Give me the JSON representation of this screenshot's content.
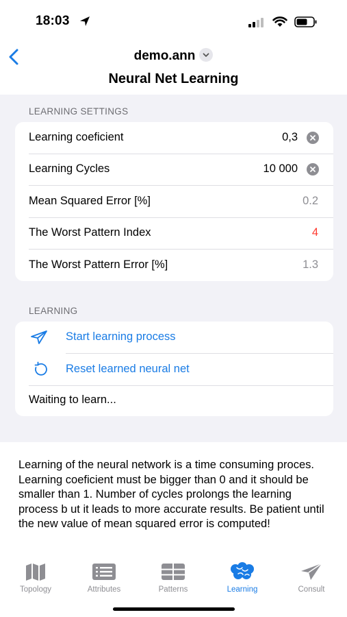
{
  "status_bar": {
    "time": "18:03",
    "icons": [
      "location-arrow-icon",
      "cellular-signal-icon",
      "wifi-icon",
      "battery-icon"
    ]
  },
  "nav": {
    "back_icon": "chevron-left-icon",
    "app_name": "demo.ann",
    "title": "Neural Net Learning"
  },
  "settings": {
    "header": "LEARNING SETTINGS",
    "rows": [
      {
        "label": "Learning coeficient",
        "value": "0,3",
        "editable": true
      },
      {
        "label": "Learning Cycles",
        "value": "10 000",
        "editable": true
      },
      {
        "label": "Mean Squared Error [%]",
        "value": "0.2"
      },
      {
        "label": "The Worst Pattern Index",
        "value": "4",
        "color": "#ff3b30"
      },
      {
        "label": "The Worst Pattern Error [%]",
        "value": "1.3"
      }
    ]
  },
  "learning": {
    "header": "LEARNING",
    "start_label": "Start learning process",
    "reset_label": "Reset learned neural net",
    "status": "Waiting to learn..."
  },
  "description": "Learning of the neural network is a time consuming proces. Learning coeficient must be bigger than 0 and it should be smaller than 1. Number of cycles prolongs the learning process b ut it leads to more accurate results. Be patient until the new value of mean squared error is computed!",
  "tabs": [
    {
      "label": "Topology",
      "icon": "map-icon"
    },
    {
      "label": "Attributes",
      "icon": "list-icon"
    },
    {
      "label": "Patterns",
      "icon": "table-icon"
    },
    {
      "label": "Learning",
      "icon": "brain-icon",
      "active": true
    },
    {
      "label": "Consult",
      "icon": "paper-plane-icon"
    }
  ],
  "colors": {
    "accent": "#1a7ce5",
    "alert": "#ff3b30",
    "group_background": "#f2f2f7"
  }
}
